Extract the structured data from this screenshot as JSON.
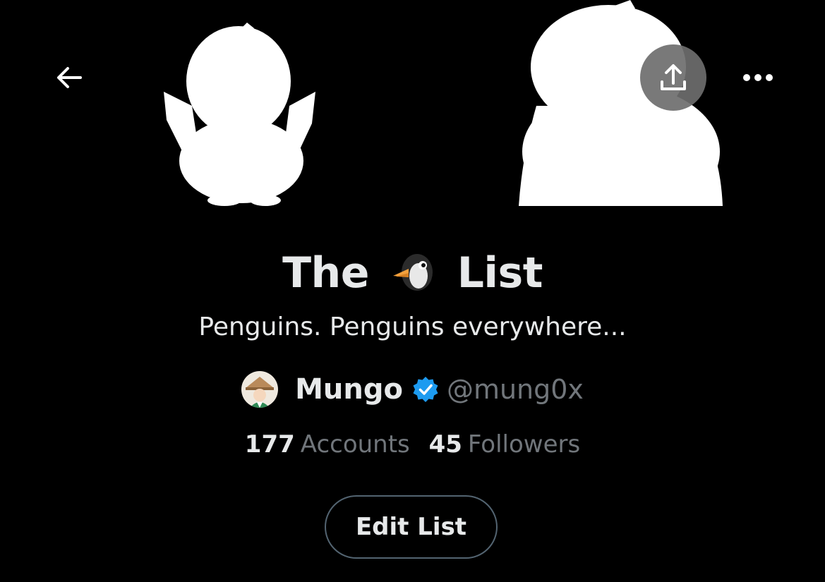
{
  "header": {
    "back_icon": "arrow-left-icon",
    "share_icon": "share-upload-icon",
    "more_icon": "more-horizontal-icon"
  },
  "list": {
    "title_prefix": "The",
    "title_emoji": "penguin-emoji",
    "title_suffix": "List",
    "description": "Penguins. Penguins everywhere..."
  },
  "owner": {
    "name": "Mungo",
    "handle": "@mung0x",
    "verified": true,
    "verified_color": "#1d9bf0"
  },
  "stats": {
    "accounts_count": "177",
    "accounts_label": "Accounts",
    "followers_count": "45",
    "followers_label": "Followers"
  },
  "actions": {
    "edit_label": "Edit List"
  },
  "colors": {
    "background": "#000000",
    "primary_text": "#e7e9ea",
    "secondary_text": "#71767b",
    "button_border": "#536471"
  }
}
